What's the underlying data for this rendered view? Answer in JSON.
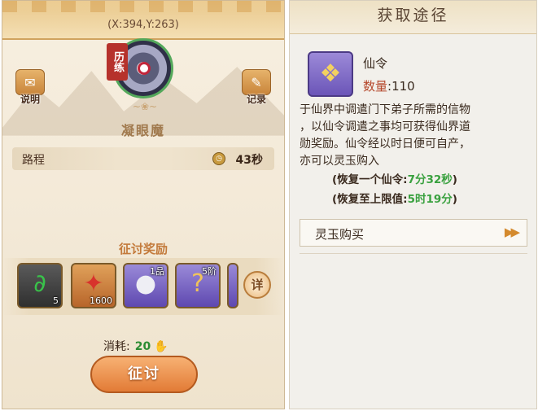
{
  "left": {
    "coords": "(X:394,Y:263)",
    "help_label": "说明",
    "record_label": "记录",
    "tag_label": "历练",
    "enemy_name": "凝眼魔",
    "route_label": "路程",
    "route_time": "43秒",
    "reward_title": "征讨奖励",
    "rewards": [
      {
        "icon": "green-jade-ring-icon",
        "count": "5",
        "tl": ""
      },
      {
        "icon": "red-phoenix-feather-icon",
        "count": "1600",
        "tl": ""
      },
      {
        "icon": "white-egg-icon",
        "count": "",
        "tl": "1品"
      },
      {
        "icon": "mystery-chest-icon",
        "count": "",
        "tl": "5阶"
      }
    ],
    "detail_label": "详",
    "cost_label": "消耗:",
    "cost_value": "20",
    "go_label": "征讨"
  },
  "right": {
    "header": "获取途径",
    "item_name": "仙令",
    "qty_label": "数量",
    "qty_value": ":110",
    "desc_lines": [
      "于仙界中调遣门下弟子所需的信物",
      "，以仙令调遣之事均可获得仙界道",
      "勋奖励。仙令经以时日便可自产，",
      "亦可以灵玉购入"
    ],
    "recover_one_label": "(恢复一个仙令:",
    "recover_one_value": "7分32秒",
    "recover_full_label": "(恢复至上限值:",
    "recover_full_value": "5时19分",
    "close_paren": ")",
    "buy_label": "灵玉购买",
    "colors": {
      "accent_green": "#3aa13f",
      "accent_orange": "#e27b36"
    }
  }
}
